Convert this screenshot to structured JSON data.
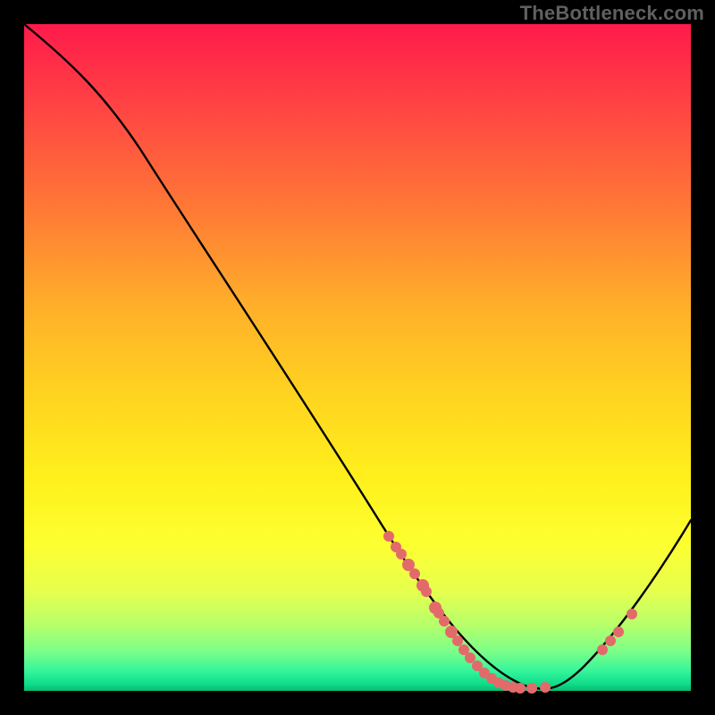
{
  "watermark": "TheBottleneck.com",
  "colors": {
    "point_fill": "#e36a6a",
    "curve_stroke": "#000000"
  },
  "chart_data": {
    "type": "line",
    "title": "",
    "xlabel": "",
    "ylabel": "",
    "xlim": [
      0,
      100
    ],
    "ylim": [
      0,
      100
    ],
    "x": [
      0,
      5,
      10,
      15,
      20,
      25,
      30,
      35,
      40,
      45,
      50,
      55,
      60,
      65,
      68,
      72,
      76,
      80,
      85,
      90,
      95,
      100
    ],
    "values": [
      100,
      96,
      90,
      82,
      74,
      66,
      58,
      50,
      42,
      34,
      26,
      19,
      12,
      6,
      3,
      1,
      0.5,
      1.5,
      5,
      11,
      18,
      26
    ],
    "series": [
      {
        "name": "curve",
        "x": [
          0,
          5,
          10,
          15,
          20,
          25,
          30,
          35,
          40,
          45,
          50,
          55,
          60,
          65,
          68,
          72,
          76,
          80,
          85,
          90,
          95,
          100
        ],
        "y": [
          100,
          96,
          90,
          82,
          74,
          66,
          58,
          50,
          42,
          34,
          26,
          19,
          12,
          6,
          3,
          1,
          0.5,
          1.5,
          5,
          11,
          18,
          26
        ]
      },
      {
        "name": "marked-points",
        "x": [
          55,
          56,
          57,
          58,
          59,
          60,
          60.5,
          62,
          62.5,
          63,
          64,
          65,
          66,
          67,
          68,
          69,
          70,
          71,
          72,
          73,
          74,
          76,
          78,
          87,
          88,
          89,
          91
        ],
        "y": [
          19,
          17.5,
          16.5,
          15,
          14,
          12,
          11,
          9.5,
          9,
          8,
          7,
          6,
          5,
          4.2,
          3,
          2.3,
          1.8,
          1.3,
          1,
          0.8,
          0.6,
          0.5,
          0.8,
          8,
          9,
          10,
          12.5
        ]
      }
    ]
  }
}
